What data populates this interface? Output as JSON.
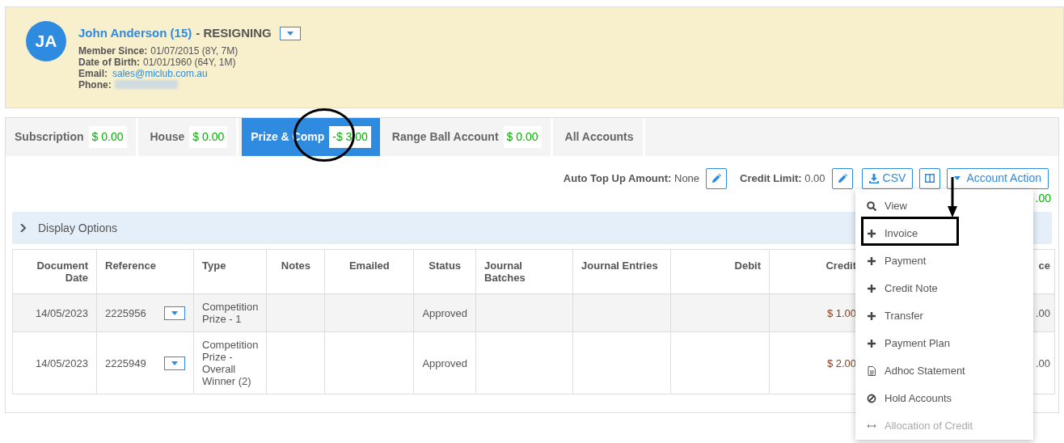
{
  "member": {
    "initials": "JA",
    "name": "John Anderson (15)",
    "status": "- RESIGNING",
    "details": [
      {
        "kind": "text",
        "label": "Member Since:",
        "value": "01/07/2015 (8Y, 7M)"
      },
      {
        "kind": "text",
        "label": "Date of Birth:",
        "value": "01/01/1960 (64Y, 1M)"
      },
      {
        "kind": "link",
        "label": "Email:",
        "value": "sales@miclub.com.au"
      },
      {
        "kind": "redacted",
        "label": "Phone:"
      }
    ]
  },
  "tabs": [
    {
      "label": "Subscription",
      "amount": "$ 0.00",
      "selected": false
    },
    {
      "label": "House",
      "amount": "$ 0.00",
      "selected": false
    },
    {
      "label": "Prize & Comp",
      "amount": "-$ 3.00",
      "selected": true
    },
    {
      "label": "Range Ball Account",
      "amount": "$ 0.00",
      "selected": false
    },
    {
      "label": "All Accounts",
      "selected": false
    }
  ],
  "toolbar": {
    "auto_top_up": {
      "label": "Auto Top Up Amount:",
      "value": "None"
    },
    "credit_limit": {
      "label": "Credit Limit:",
      "value": "0.00"
    },
    "csv_button": "CSV",
    "account_action_button": "Account Action"
  },
  "balance_partial": ".00",
  "display_options": {
    "label": "Display Options",
    "expanded": false
  },
  "table": {
    "columns": [
      "Document Date",
      "Reference",
      "Type",
      "Notes",
      "Emailed",
      "Status",
      "Journal Batches",
      "Journal Entries",
      "Debit",
      "Credit",
      "ce"
    ],
    "rows": [
      {
        "cells": [
          "14/05/2023",
          "2225956",
          "Competition Prize - 1",
          "",
          "",
          "Approved",
          "",
          "",
          "",
          "$ 1.00",
          ".00"
        ]
      },
      {
        "cells": [
          "14/05/2023",
          "2225949",
          "Competition Prize - Overall Winner (2)",
          "",
          "",
          "Approved",
          "",
          "",
          "",
          "$ 2.00",
          ".00"
        ]
      }
    ]
  },
  "menu": {
    "items": [
      {
        "kind": "search",
        "label": "View",
        "disabled": false
      },
      {
        "kind": "plus",
        "label": "Invoice",
        "disabled": false
      },
      {
        "kind": "plus",
        "label": "Payment",
        "disabled": false
      },
      {
        "kind": "plus",
        "label": "Credit Note",
        "disabled": false
      },
      {
        "kind": "plus",
        "label": "Transfer",
        "disabled": false
      },
      {
        "kind": "plus",
        "label": "Payment Plan",
        "disabled": false
      },
      {
        "kind": "document",
        "label": "Adhoc Statement",
        "disabled": false
      },
      {
        "kind": "ban",
        "label": "Hold Accounts",
        "disabled": false
      },
      {
        "kind": "arrows",
        "label": "Allocation of Credit",
        "disabled": true
      }
    ]
  }
}
